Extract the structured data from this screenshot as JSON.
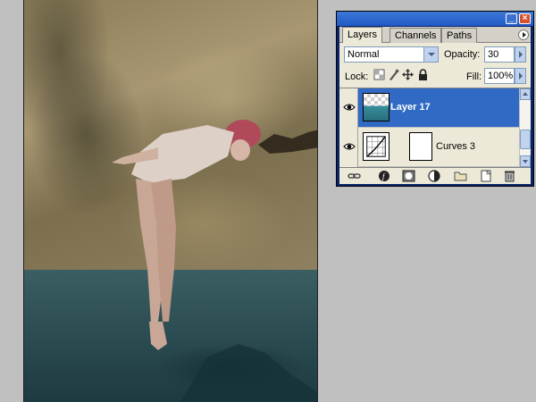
{
  "palette": {
    "tabs": [
      {
        "label": "Layers",
        "active": true
      },
      {
        "label": "Channels",
        "active": false
      },
      {
        "label": "Paths",
        "active": false
      }
    ],
    "blend_mode": "Normal",
    "opacity_label": "Opacity:",
    "opacity_value": "30",
    "lock_label": "Lock:",
    "fill_label": "Fill:",
    "fill_value": "100%",
    "layers": [
      {
        "name": "Layer 17",
        "visible": true,
        "selected": true
      },
      {
        "name": "Curves 3",
        "visible": true,
        "selected": false
      }
    ]
  },
  "icons": {
    "visibility": "eye-icon",
    "lock_transparent": "checkerboard-lock-icon",
    "lock_image": "brush-lock-icon",
    "lock_position": "move-lock-icon",
    "lock_all": "padlock-icon",
    "bottom_bar": [
      "link-icon",
      "layer-style-icon",
      "mask-icon",
      "adjustment-layer-icon",
      "group-icon",
      "new-layer-icon",
      "trash-icon"
    ]
  },
  "colors": {
    "selection": "#316ac5",
    "title_bar": "#2059c4",
    "workspace": "#c0c0c0"
  }
}
